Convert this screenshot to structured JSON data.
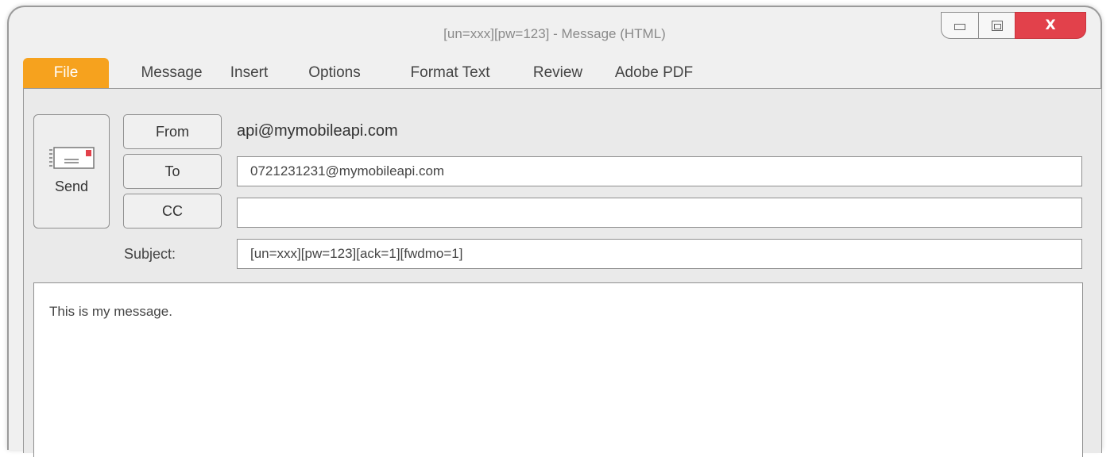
{
  "window": {
    "title": "[un=xxx][pw=123] - Message (HTML)",
    "controls": {
      "minimize_icon": "minimize-icon",
      "maximize_icon": "restore-icon",
      "close_label": "X"
    }
  },
  "ribbon": {
    "tabs": [
      {
        "label": "File",
        "active": true
      },
      {
        "label": "Message"
      },
      {
        "label": "Insert"
      },
      {
        "label": "Options"
      },
      {
        "label": "Format Text"
      },
      {
        "label": "Review"
      },
      {
        "label": "Adobe PDF"
      }
    ]
  },
  "compose": {
    "send_label": "Send",
    "send_icon": "envelope-icon",
    "from_label": "From",
    "from_value": "api@mymobileapi.com",
    "to_label": "To",
    "to_value": "0721231231@mymobileapi.com",
    "cc_label": "CC",
    "cc_value": "",
    "subject_label": "Subject:",
    "subject_value": "[un=xxx][pw=123][ack=1][fwdmo=1]",
    "body": "This is my message."
  },
  "colors": {
    "file_tab": "#f6a21e",
    "close_button": "#e2414b",
    "envelope_flag": "#e2414b"
  }
}
